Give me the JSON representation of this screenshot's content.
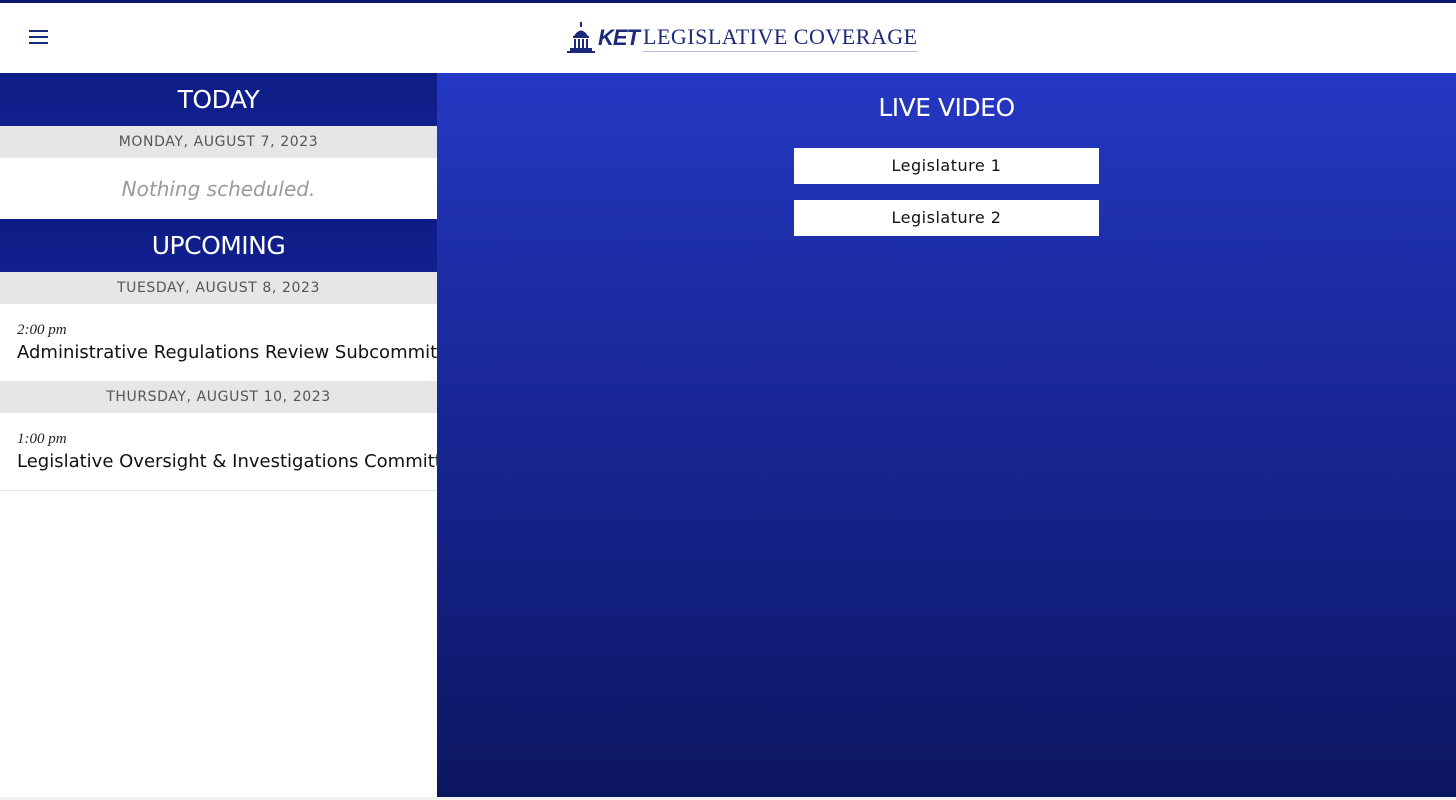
{
  "header": {
    "logo_ket": "KET",
    "logo_title": "LEGISLATIVE COVERAGE",
    "menu_icon": "hamburger-menu-icon",
    "logo_icon": "capitol-dome-icon"
  },
  "colors": {
    "brand": "#1b2a7a",
    "section_header": "#0e1c86",
    "live_gradient_top": "#2538c4",
    "live_gradient_bottom": "#0c1660"
  },
  "today": {
    "heading": "TODAY",
    "date": "MONDAY, AUGUST 7, 2023",
    "empty_text": "Nothing scheduled."
  },
  "upcoming": {
    "heading": "UPCOMING",
    "days": [
      {
        "date": "TUESDAY, AUGUST 8, 2023",
        "events": [
          {
            "time": "2:00 pm",
            "title": "Administrative Regulations Review Subcommittee"
          }
        ]
      },
      {
        "date": "THURSDAY, AUGUST 10, 2023",
        "events": [
          {
            "time": "1:00 pm",
            "title": "Legislative Oversight & Investigations Committee"
          }
        ]
      }
    ]
  },
  "live_video": {
    "heading": "LIVE VIDEO",
    "streams": [
      "Legislature 1",
      "Legislature 2"
    ]
  }
}
